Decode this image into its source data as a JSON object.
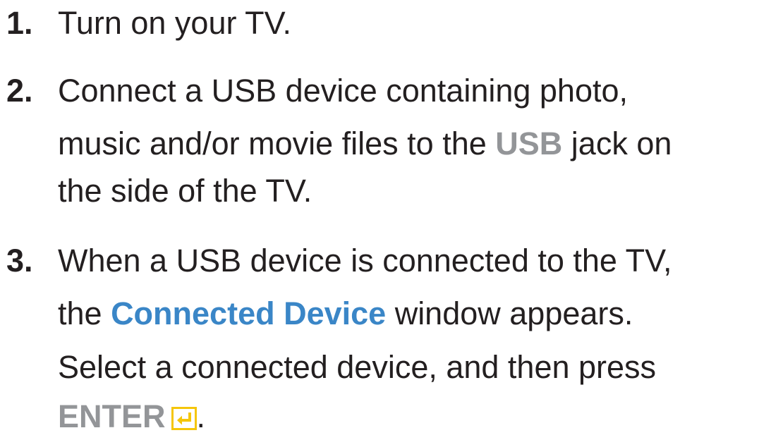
{
  "steps": [
    {
      "number": "1.",
      "line1": "Turn on your TV."
    },
    {
      "number": "2.",
      "line1": "Connect a USB device containing photo,",
      "line2_prefix": "music and/or movie files to the ",
      "line2_highlight": "USB",
      "line2_suffix": " jack on",
      "line3": "the side of the TV."
    },
    {
      "number": "3.",
      "line1": "When a USB device is connected to the TV,",
      "line2_prefix": "the ",
      "line2_highlight": "Connected Device",
      "line2_suffix": " window appears.",
      "line3": "Select a connected device, and then press",
      "line4_key": "ENTER",
      "line4_icon": "enter-key-icon",
      "line4_suffix": "."
    }
  ],
  "colors": {
    "text": "#231f20",
    "gray_highlight": "#939598",
    "blue_highlight": "#3a86c7",
    "icon_yellow": "#f5c60a"
  }
}
